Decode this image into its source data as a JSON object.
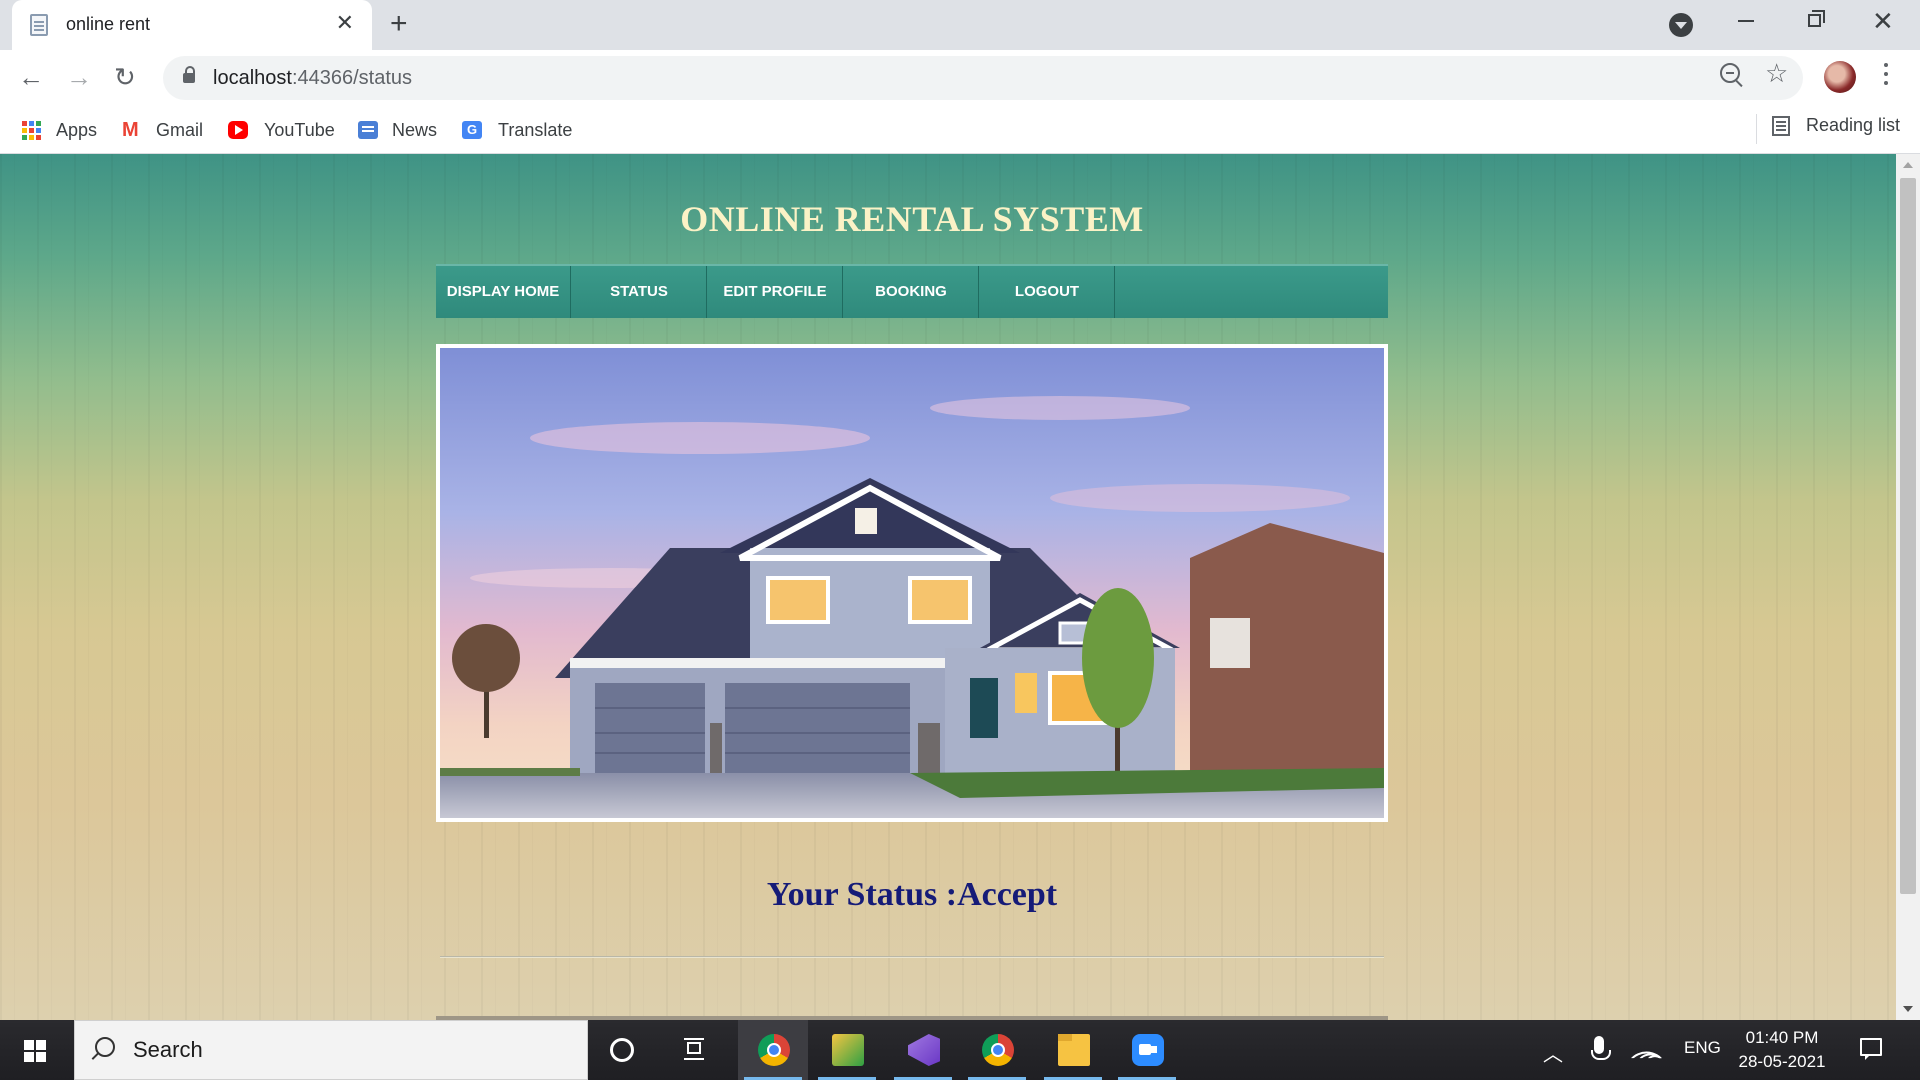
{
  "browser": {
    "tab_title": "online rent",
    "url_host": "localhost",
    "url_rest": ":44366/status",
    "bookmarks": [
      {
        "label": "Apps",
        "icon": "apps-grid-icon"
      },
      {
        "label": "Gmail",
        "icon": "gmail-icon"
      },
      {
        "label": "YouTube",
        "icon": "youtube-icon"
      },
      {
        "label": "News",
        "icon": "news-icon"
      },
      {
        "label": "Translate",
        "icon": "translate-icon"
      }
    ],
    "reading_list": "Reading list"
  },
  "page": {
    "site_title": "ONLINE RENTAL SYSTEM",
    "nav": [
      {
        "label": "DISPLAY HOME"
      },
      {
        "label": "STATUS"
      },
      {
        "label": "EDIT PROFILE"
      },
      {
        "label": "BOOKING"
      },
      {
        "label": "LOGOUT"
      }
    ],
    "hero_image": "house-photo",
    "status_text": "Your Status :Accept",
    "colors": {
      "title": "#fbf2c6",
      "nav_bg": "#339185",
      "status_text": "#151b78"
    }
  },
  "taskbar": {
    "search_label": "Search",
    "lang": "ENG",
    "time": "01:40 PM",
    "date": "28-05-2021"
  }
}
